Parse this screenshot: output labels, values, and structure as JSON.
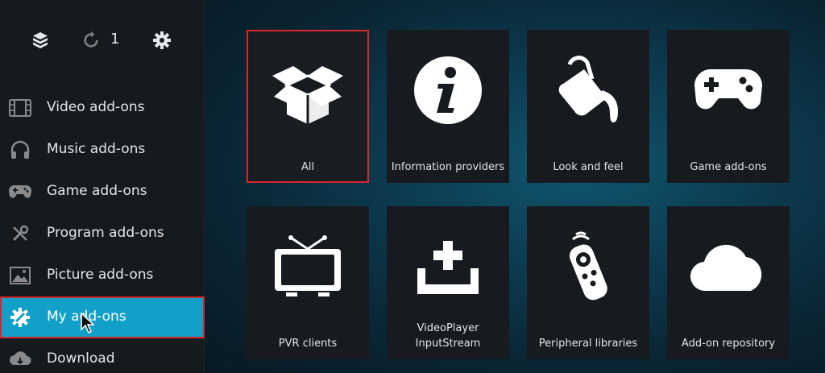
{
  "topbar": {
    "count": "1"
  },
  "sidebar": {
    "items": [
      {
        "label": "Video add-ons",
        "icon": "film-icon"
      },
      {
        "label": "Music add-ons",
        "icon": "headphones-icon"
      },
      {
        "label": "Game add-ons",
        "icon": "gamepad-icon"
      },
      {
        "label": "Program add-ons",
        "icon": "tools-icon"
      },
      {
        "label": "Picture add-ons",
        "icon": "picture-icon"
      },
      {
        "label": "My add-ons",
        "icon": "addon-gear-icon",
        "active": true
      },
      {
        "label": "Download",
        "icon": "cloud-download-icon"
      }
    ]
  },
  "grid": {
    "tiles": [
      {
        "label": "All",
        "icon": "open-box-icon",
        "focused": true
      },
      {
        "label": "Information providers",
        "icon": "info-icon"
      },
      {
        "label": "Look and feel",
        "icon": "paint-bucket-icon"
      },
      {
        "label": "Game add-ons",
        "icon": "gamepad-icon"
      },
      {
        "label": "PVR clients",
        "icon": "tv-icon"
      },
      {
        "label": "VideoPlayer InputStream",
        "icon": "input-tray-icon"
      },
      {
        "label": "Peripheral libraries",
        "icon": "remote-icon"
      },
      {
        "label": "Add-on repository",
        "icon": "cloud-icon"
      }
    ]
  },
  "colors": {
    "accent": "#12a0c8",
    "focus_border": "#d8262b",
    "sidebar_bg": "#151a1f",
    "tile_bg": "#171b20"
  }
}
